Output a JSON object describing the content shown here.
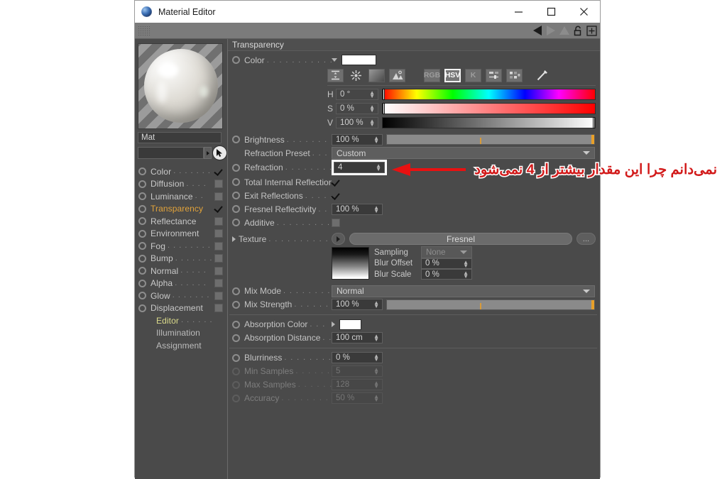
{
  "window": {
    "title": "Material Editor",
    "icon": "material-sphere-icon",
    "minimize": "—",
    "maximize": "□",
    "close": "✕"
  },
  "toolbar": {
    "grip": "drag-grip",
    "icons": [
      "prev-material-arrow",
      "next-material-arrow",
      "up-level-arrow",
      "lock-icon",
      "add-icon"
    ]
  },
  "material": {
    "preview_label": "material-preview-sphere",
    "name": "Mat",
    "search_value": "",
    "pick_cursor": "pick-cursor-icon"
  },
  "channels": [
    {
      "label": "Color",
      "dots": ". . . . . . .",
      "checked": true,
      "active": false
    },
    {
      "label": "Diffusion",
      "dots": ". . . .",
      "checked": false,
      "active": false
    },
    {
      "label": "Luminance",
      "dots": ". .",
      "checked": false,
      "active": false
    },
    {
      "label": "Transparency",
      "dots": "",
      "checked": true,
      "active": true
    },
    {
      "label": "Reflectance",
      "dots": "",
      "checked": false,
      "active": false
    },
    {
      "label": "Environment",
      "dots": "",
      "checked": false,
      "active": false
    },
    {
      "label": "Fog",
      "dots": ". . . . . . . .",
      "checked": false,
      "active": false
    },
    {
      "label": "Bump",
      "dots": ". . . . . . .",
      "checked": false,
      "active": false
    },
    {
      "label": "Normal",
      "dots": ". . . . .",
      "checked": false,
      "active": false
    },
    {
      "label": "Alpha",
      "dots": ". . . . . .",
      "checked": false,
      "active": false
    },
    {
      "label": "Glow",
      "dots": ". . . . . . .",
      "checked": false,
      "active": false
    },
    {
      "label": "Displacement",
      "dots": "",
      "checked": false,
      "active": false
    }
  ],
  "channel_pages": [
    {
      "label": "Editor",
      "dots": ". . . . . ."
    },
    {
      "label": "Illumination",
      "dots": ""
    },
    {
      "label": "Assignment",
      "dots": ""
    }
  ],
  "transparency": {
    "section_title": "Transparency",
    "color": {
      "label": "Color",
      "dots": ". . . . . . . . . . . . .",
      "swatch_hex": "#ffffff"
    },
    "color_modes": {
      "icons": [
        "range-icon",
        "color-wheel-icon",
        "gradient-icon",
        "picture-icon"
      ],
      "models": [
        "RGB",
        "HSV",
        "K"
      ],
      "selected_model": "HSV",
      "extra_icons": [
        "sliders-icon",
        "swatches-icon",
        "eyedropper-icon"
      ]
    },
    "hsv": [
      {
        "label": "H",
        "value": "0 °",
        "handle_pct": 0
      },
      {
        "label": "S",
        "value": "0 %",
        "handle_pct": 0
      },
      {
        "label": "V",
        "value": "100 %",
        "handle_pct": 100
      }
    ],
    "brightness": {
      "label": "Brightness",
      "dots": ". . . . . . . . . . .",
      "value": "100 %",
      "tick_pct": 45
    },
    "refraction_preset": {
      "label": "Refraction Preset",
      "dots": ". . . . . .",
      "value": "Custom"
    },
    "refraction": {
      "label": "Refraction",
      "dots": ". . . . . . . . . . .",
      "value": "4",
      "highlighted": true
    },
    "total_internal_reflection": {
      "label": "Total Internal Reflection",
      "dots": "",
      "checked": true
    },
    "exit_reflections": {
      "label": "Exit Reflections",
      "dots": ". . . . . . .",
      "checked": true
    },
    "fresnel_reflectivity": {
      "label": "Fresnel Reflectivity",
      "dots": ". . . .",
      "value": "100 %"
    },
    "additive": {
      "label": "Additive",
      "dots": ". . . . . . . . . . . . .",
      "checked": false
    },
    "texture": {
      "label": "Texture",
      "dots": ". . . . . . . . . . . . .",
      "value": "Fresnel",
      "browse_label": "...",
      "thumbnail": "gradient-thumbnail",
      "sampling_label": "Sampling",
      "sampling_value": "None",
      "blur_offset_label": "Blur Offset",
      "blur_offset_value": "0 %",
      "blur_scale_label": "Blur Scale",
      "blur_scale_value": "0 %"
    },
    "mix_mode": {
      "label": "Mix Mode",
      "dots": ". . . . . . . . . . .",
      "value": "Normal"
    },
    "mix_strength": {
      "label": "Mix Strength",
      "dots": ". . . . . . . . .",
      "value": "100 %",
      "tick_pct": 45
    },
    "absorption_color": {
      "label": "Absorption Color",
      "dots": ". . .",
      "swatch_hex": "#ffffff"
    },
    "absorption_distance": {
      "label": "Absorption Distance",
      "dots": ". . .",
      "value": "100 cm"
    },
    "blurriness": {
      "label": "Blurriness",
      "dots": ". . . . . . . . . . . .",
      "value": "0 %"
    },
    "min_samples": {
      "label": "Min Samples",
      "dots": ". . . . . . . . .",
      "value": "5",
      "disabled": true
    },
    "max_samples": {
      "label": "Max Samples",
      "dots": ". . . . . . . . .",
      "value": "128",
      "disabled": true
    },
    "accuracy": {
      "label": "Accuracy",
      "dots": ". . . . . . . . . . . . .",
      "value": "50 %",
      "disabled": true
    }
  },
  "annotation": {
    "text": "نمی‌دانم چرا این مقدار بیشتر از 4 نمی‌شود",
    "arrow": "red-left-arrow",
    "color": "#d21a1a"
  }
}
